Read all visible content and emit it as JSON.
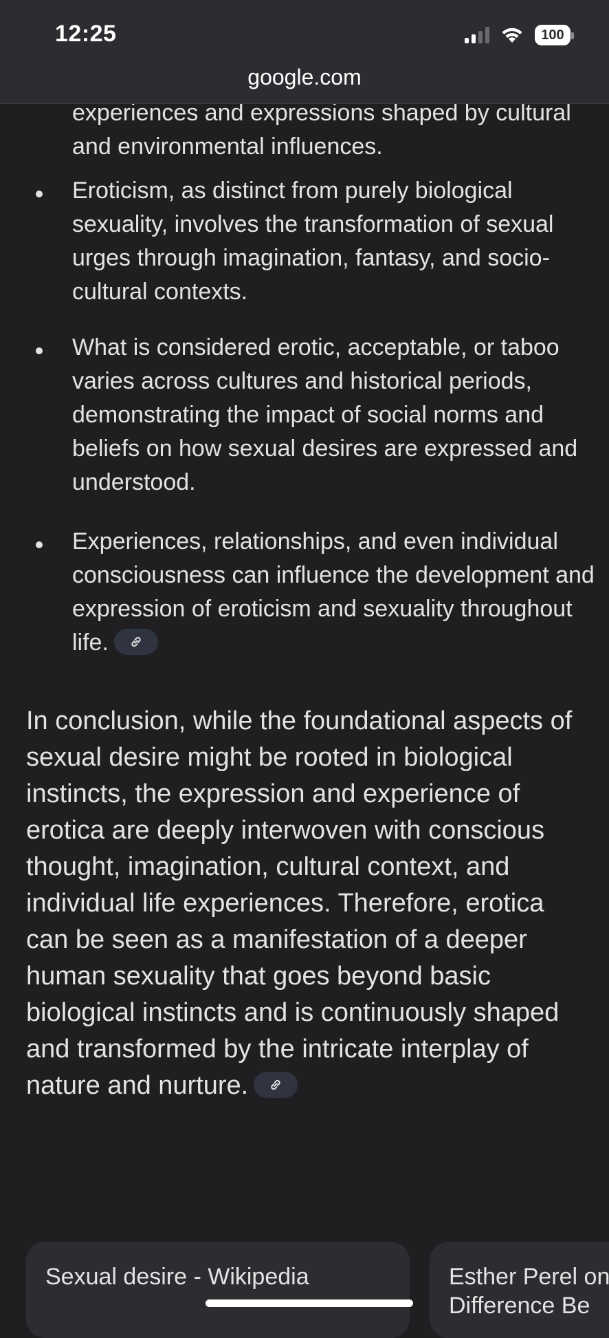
{
  "status_bar": {
    "time": "12:25",
    "battery": "100",
    "url": "google.com"
  },
  "bullets": [
    {
      "text": "experiences and expressions shaped by cultural and environmental influences.",
      "has_link": false,
      "has_dot": false
    },
    {
      "text": "Eroticism, as distinct from purely biological sexuality, involves the transformation of sexual urges through imagination, fantasy, and socio-cultural contexts.",
      "has_link": false,
      "has_dot": true
    },
    {
      "text": "What is considered erotic, acceptable, or taboo varies across cultures and historical periods, demonstrating the impact of social norms and beliefs on how sexual desires are expressed and understood.",
      "has_link": false,
      "has_dot": true
    },
    {
      "text": "Experiences, relationships, and even individual consciousness can influence the development and expression of eroticism and sexuality throughout life.",
      "has_link": true,
      "has_dot": true
    }
  ],
  "conclusion": "In conclusion, while the foundational aspects of sexual desire might be rooted in biological instincts, the expression and experience of erotica are deeply interwoven with conscious thought, imagination, cultural context, and individual life experiences. Therefore, erotica can be seen as a manifestation of a deeper human sexuality that goes beyond basic biological instincts and is continuously shaped and transformed by the intricate interplay of nature and nurture.",
  "source_cards": [
    {
      "title": "Sexual desire - Wikipedia"
    },
    {
      "title": "Esther Perel on Difference Be"
    }
  ],
  "icons": {
    "link": "link-icon",
    "signal": "cellular-signal-icon",
    "wifi": "wifi-icon",
    "battery": "battery-icon"
  }
}
